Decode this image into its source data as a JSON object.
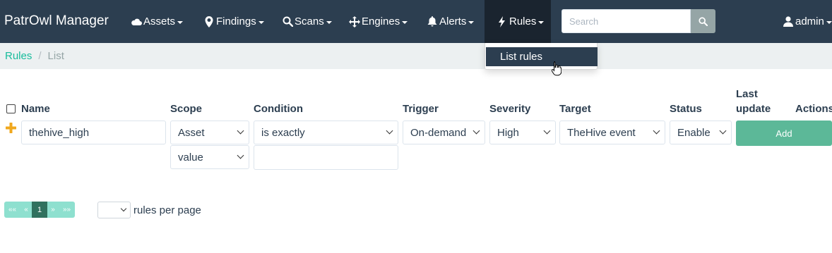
{
  "navbar": {
    "brand": "PatrOwl Manager",
    "items": [
      {
        "label": "Assets",
        "icon": "cloud-icon"
      },
      {
        "label": "Findings",
        "icon": "map-marker-icon"
      },
      {
        "label": "Scans",
        "icon": "search-icon"
      },
      {
        "label": "Engines",
        "icon": "move-icon"
      },
      {
        "label": "Alerts",
        "icon": "bell-icon"
      },
      {
        "label": "Rules",
        "icon": "flash-icon"
      }
    ],
    "search_placeholder": "Search",
    "search_value": "",
    "user": "admin"
  },
  "dropdown": {
    "items": [
      {
        "label": "List rules"
      }
    ]
  },
  "breadcrumb": {
    "root": "Rules",
    "separator": "/",
    "current": "List"
  },
  "table": {
    "headers": {
      "name": "Name",
      "scope": "Scope",
      "condition": "Condition",
      "trigger": "Trigger",
      "severity": "Severity",
      "target": "Target",
      "status": "Status",
      "last_update_1": "Last",
      "last_update_2": "update",
      "actions": "Actions"
    },
    "new_rule": {
      "name": "thehive_high",
      "scope": "Asset",
      "scope_attr": "value",
      "condition": "is exactly",
      "condition_value": "",
      "trigger": "On-demand",
      "severity": "High",
      "target": "TheHive event",
      "status": "Enable",
      "add_label": "Add"
    }
  },
  "pagination": {
    "first": "««",
    "prev": "«",
    "page": "1",
    "next": "»",
    "last": "»»",
    "per_page_value": "",
    "per_page_label": "rules per page"
  },
  "colors": {
    "navbar": "#2c3e50",
    "accent": "#18bc9c",
    "add_button": "#5cb898"
  }
}
